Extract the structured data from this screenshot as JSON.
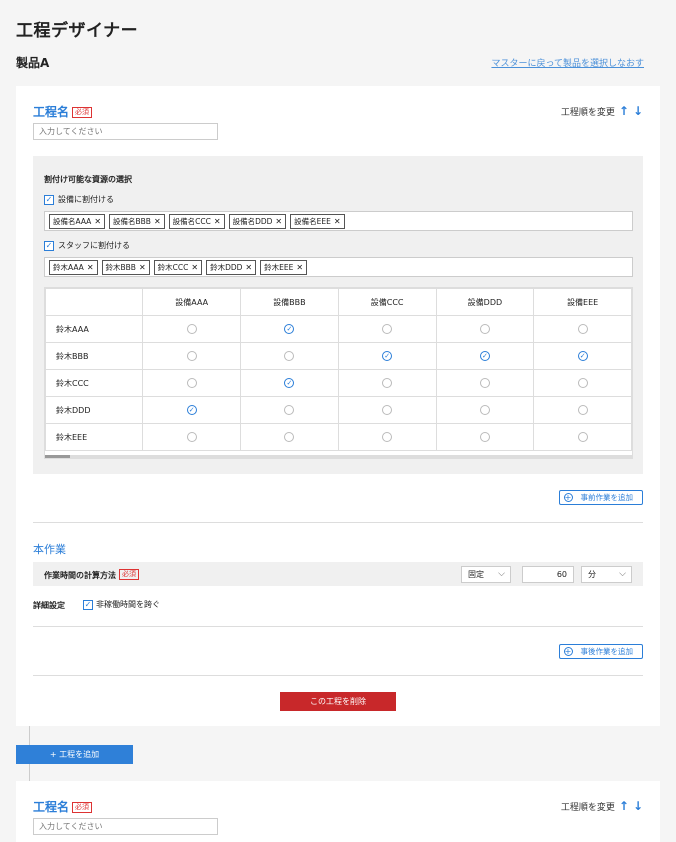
{
  "app_title": "工程デザイナー",
  "product_title": "製品A",
  "back_link": "マスターに戻って製品を選択しなおす",
  "step": {
    "name_label": "工程名",
    "required": "必須",
    "name_placeholder": "入力してください",
    "order_change": "工程順を変更",
    "up_arrow": "↑",
    "down_arrow": "↓"
  },
  "resources": {
    "title": "割付け可能な資源の選択",
    "equipment_check_label": "設備に割付ける",
    "equipment_tags": [
      "設備名AAA",
      "設備名BBB",
      "設備名CCC",
      "設備名DDD",
      "設備名EEE"
    ],
    "staff_check_label": "スタッフに割付ける",
    "staff_tags": [
      "鈴木AAA",
      "鈴木BBB",
      "鈴木CCC",
      "鈴木DDD",
      "鈴木EEE"
    ],
    "tag_remove": "✕",
    "check_mark": "✓"
  },
  "matrix": {
    "columns": [
      "設備AAA",
      "設備BBB",
      "設備CCC",
      "設備DDD",
      "設備EEE"
    ],
    "rows": [
      {
        "label": "鈴木AAA",
        "selected": [
          false,
          true,
          false,
          false,
          false
        ]
      },
      {
        "label": "鈴木BBB",
        "selected": [
          false,
          false,
          true,
          true,
          true
        ]
      },
      {
        "label": "鈴木CCC",
        "selected": [
          false,
          true,
          false,
          false,
          false
        ]
      },
      {
        "label": "鈴木DDD",
        "selected": [
          true,
          false,
          false,
          false,
          false
        ]
      },
      {
        "label": "鈴木EEE",
        "selected": [
          false,
          false,
          false,
          false,
          false
        ]
      }
    ]
  },
  "pre_work_button": "事前作業を追加",
  "main_work": {
    "title": "本作業",
    "calc_label": "作業時間の計算方法",
    "calc_method": "固定",
    "duration": "60",
    "unit": "分",
    "detail_label": "詳細設定",
    "detail_check_label": "非稼働時間を跨ぐ"
  },
  "post_work_button": "事後作業を追加",
  "delete_button": "この工程を削除",
  "add_step_button": "+ 工程を追加",
  "colors": {
    "accent": "#2b7ed8",
    "danger": "#c8282a",
    "primary_button": "#2f80d8"
  }
}
